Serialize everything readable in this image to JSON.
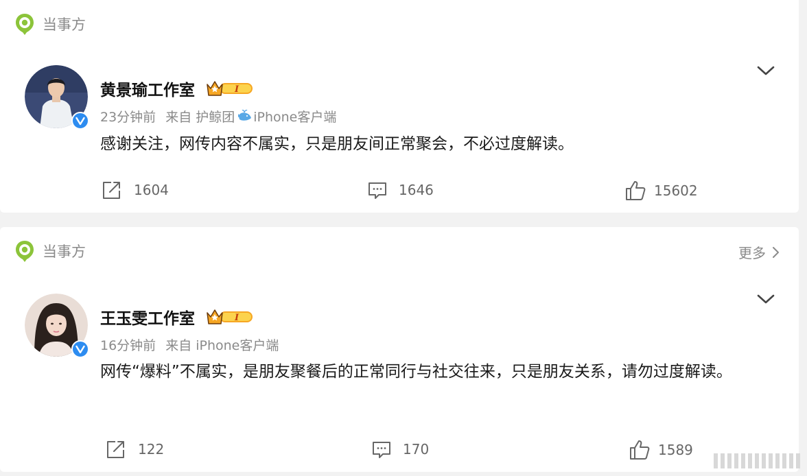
{
  "posts": [
    {
      "section_title": "当事方",
      "author": "黄景瑜工作室",
      "time": "23分钟前",
      "source_prefix": "来自",
      "source_a": "护鲸团",
      "source_b": "iPhone客户端",
      "content": "感谢关注，网传内容不属实，只是朋友间正常聚会，不必过度解读。",
      "reposts": "1604",
      "comments": "1646",
      "likes": "15602"
    },
    {
      "section_title": "当事方",
      "more_label": "更多",
      "author": "王玉雯工作室",
      "time": "16分钟前",
      "source_prefix": "来自",
      "source": "iPhone客户端",
      "content": "网传“爆料”不属实，是朋友聚餐后的正常同行与社交往来，只是朋友关系，请勿过度解读。",
      "reposts": "122",
      "comments": "170",
      "likes": "1589"
    }
  ],
  "icons": {
    "section": "location-pin-icon",
    "verified": "verified-v-icon",
    "vip": "vip-crown-badge",
    "repost": "repost-icon",
    "comment": "comment-icon",
    "like": "thumbs-up-icon",
    "menu": "chevron-down-icon"
  },
  "colors": {
    "accent_green": "#8cc43a",
    "verified_blue": "#2d8cf0",
    "vip_gold": "#f6a623",
    "text_gray": "#8a8a8a"
  }
}
